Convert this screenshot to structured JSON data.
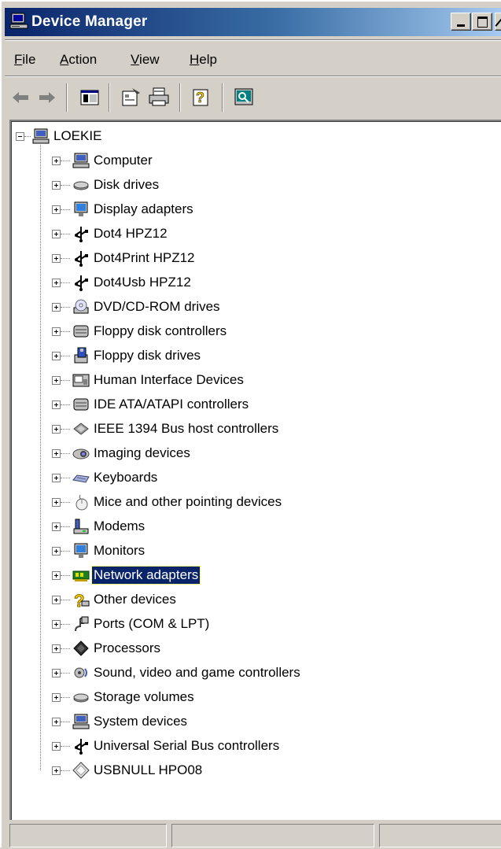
{
  "window": {
    "title": "Device Manager"
  },
  "menu": [
    {
      "pre": "",
      "ul": "F",
      "post": "ile"
    },
    {
      "pre": "",
      "ul": "A",
      "post": "ction"
    },
    {
      "pre": "",
      "ul": "V",
      "post": "iew"
    },
    {
      "pre": "",
      "ul": "H",
      "post": "elp"
    }
  ],
  "tree": {
    "root": {
      "label": "LOEKIE",
      "icon": "computer-icon"
    },
    "items": [
      {
        "label": "Computer",
        "icon": "computer-icon"
      },
      {
        "label": "Disk drives",
        "icon": "disk-drive-icon"
      },
      {
        "label": "Display adapters",
        "icon": "monitor-icon"
      },
      {
        "label": "Dot4 HPZ12",
        "icon": "usb-icon"
      },
      {
        "label": "Dot4Print HPZ12",
        "icon": "usb-icon"
      },
      {
        "label": "Dot4Usb HPZ12",
        "icon": "usb-icon"
      },
      {
        "label": "DVD/CD-ROM drives",
        "icon": "cd-drive-icon"
      },
      {
        "label": "Floppy disk controllers",
        "icon": "controller-icon"
      },
      {
        "label": "Floppy disk drives",
        "icon": "floppy-icon"
      },
      {
        "label": "Human Interface Devices",
        "icon": "hid-icon"
      },
      {
        "label": "IDE ATA/ATAPI controllers",
        "icon": "controller-icon"
      },
      {
        "label": "IEEE 1394 Bus host controllers",
        "icon": "ieee1394-icon"
      },
      {
        "label": "Imaging devices",
        "icon": "camera-icon"
      },
      {
        "label": "Keyboards",
        "icon": "keyboard-icon"
      },
      {
        "label": "Mice and other pointing devices",
        "icon": "mouse-icon"
      },
      {
        "label": "Modems",
        "icon": "modem-icon"
      },
      {
        "label": "Monitors",
        "icon": "monitor-icon"
      },
      {
        "label": "Network adapters",
        "icon": "network-card-icon",
        "selected": true
      },
      {
        "label": "Other devices",
        "icon": "question-icon"
      },
      {
        "label": "Ports (COM & LPT)",
        "icon": "port-icon"
      },
      {
        "label": "Processors",
        "icon": "processor-icon"
      },
      {
        "label": "Sound, video and game controllers",
        "icon": "sound-icon"
      },
      {
        "label": "Storage volumes",
        "icon": "disk-drive-icon"
      },
      {
        "label": "System devices",
        "icon": "computer-icon"
      },
      {
        "label": "Universal Serial Bus controllers",
        "icon": "usb-icon"
      },
      {
        "label": "USBNULL HPO08",
        "icon": "generic-device-icon"
      }
    ]
  },
  "colors": {
    "selection": "#0a246a",
    "titlebar_start": "#0a246a",
    "titlebar_end": "#a6caf0",
    "face": "#d4d0c8"
  }
}
